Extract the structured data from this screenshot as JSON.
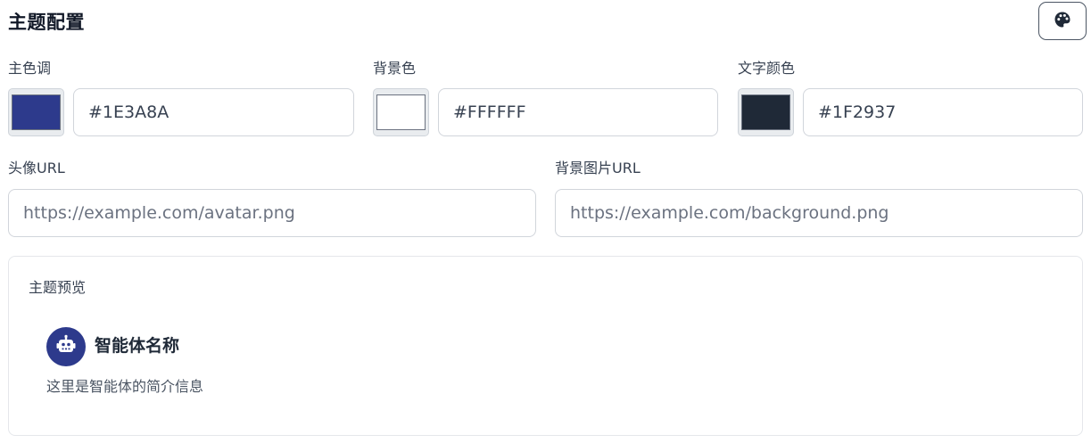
{
  "header": {
    "title": "主题配置",
    "palette_icon": "palette-icon"
  },
  "colors": {
    "primary": {
      "label": "主色调",
      "value": "#1E3A8A",
      "swatch": "#2d3a8c"
    },
    "background": {
      "label": "背景色",
      "value": "#FFFFFF",
      "swatch": "#ffffff"
    },
    "text": {
      "label": "文字颜色",
      "value": "#1F2937",
      "swatch": "#1f2937"
    }
  },
  "avatar_url": {
    "label": "头像URL",
    "placeholder": "https://example.com/avatar.png"
  },
  "background_image_url": {
    "label": "背景图片URL",
    "placeholder": "https://example.com/background.png"
  },
  "preview": {
    "title": "主题预览",
    "avatar_icon": "robot-icon",
    "agent_name": "智能体名称",
    "agent_description": "这里是智能体的简介信息"
  }
}
